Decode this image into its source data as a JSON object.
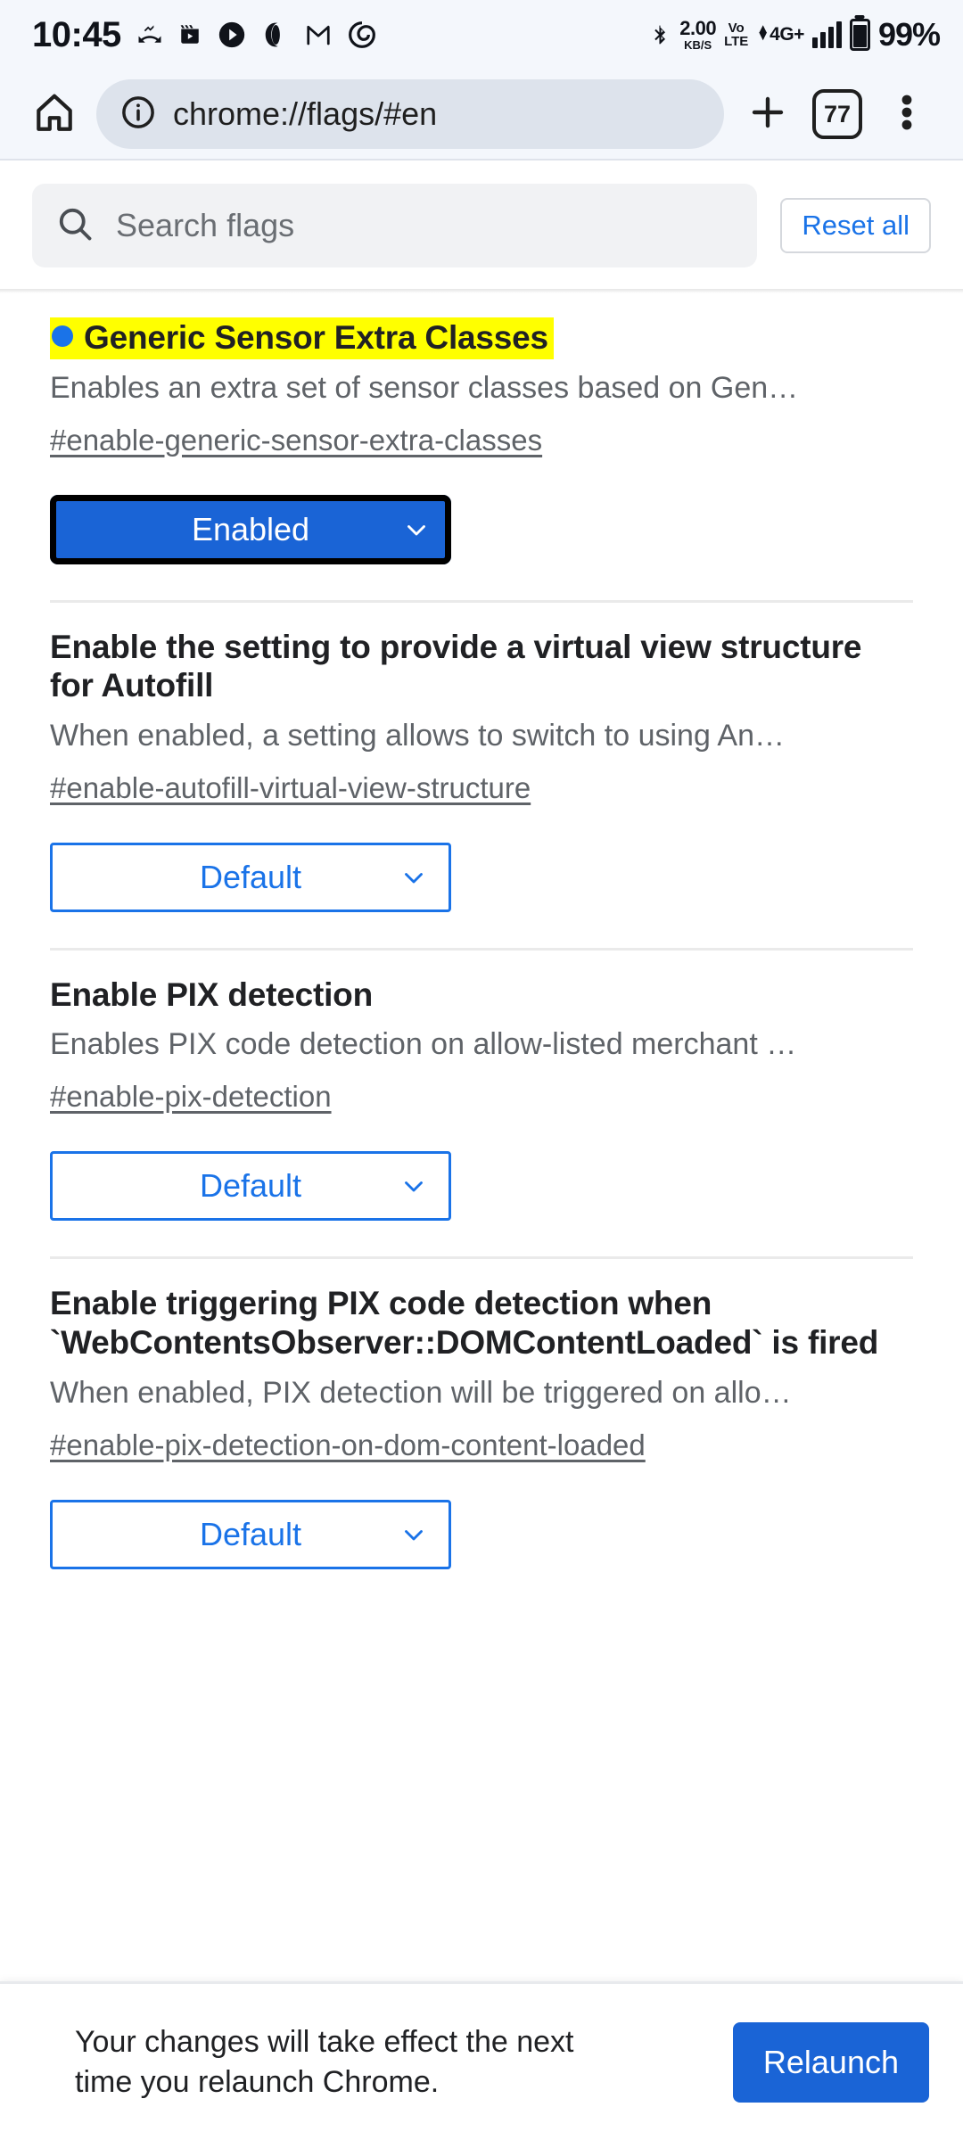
{
  "statusbar": {
    "time": "10:45",
    "icons": [
      "missed-call-icon",
      "video-camera-icon",
      "play-circle-icon",
      "opera-icon",
      "gmail-icon",
      "spiral-icon"
    ],
    "bluetooth": "bluetooth-icon",
    "net_speed_value": "2.00",
    "net_speed_unit": "KB/S",
    "volte_top": "Vo",
    "volte_bottom": "LTE",
    "network_type": "4G+",
    "battery_percent": "99%"
  },
  "toolbar": {
    "home_icon": "home-icon",
    "info_icon": "info-circle-icon",
    "url": "chrome://flags/#en",
    "new_tab_icon": "plus-icon",
    "tab_count": "77",
    "menu_icon": "more-vert-icon"
  },
  "search": {
    "icon": "search-icon",
    "placeholder": "Search flags",
    "reset_label": "Reset all"
  },
  "flags": [
    {
      "title": "Generic Sensor Extra Classes",
      "highlighted": true,
      "has_dot": true,
      "description": "Enables an extra set of sensor classes based on Gen…",
      "id": "#enable-generic-sensor-extra-classes",
      "state": "Enabled",
      "state_style": "enabled"
    },
    {
      "title": "Enable the setting to provide a virtual view structure for Autofill",
      "highlighted": false,
      "has_dot": false,
      "description": "When enabled, a setting allows to switch to using An…",
      "id": "#enable-autofill-virtual-view-structure",
      "state": "Default",
      "state_style": "default"
    },
    {
      "title": "Enable PIX detection",
      "highlighted": false,
      "has_dot": false,
      "description": "Enables PIX code detection on allow-listed merchant …",
      "id": "#enable-pix-detection",
      "state": "Default",
      "state_style": "default"
    },
    {
      "title": "Enable triggering PIX code detection when `WebContentsObserver::DOMContentLoaded` is fired",
      "highlighted": false,
      "has_dot": false,
      "description": "When enabled, PIX detection will be triggered on allo…",
      "id": "#enable-pix-detection-on-dom-content-loaded",
      "state": "Default",
      "state_style": "default"
    }
  ],
  "bottom": {
    "message": "Your changes will take effect the next time you relaunch Chrome.",
    "button_label": "Relaunch"
  },
  "colors": {
    "accent": "#1a73e8",
    "enabled_blue": "#1a64d6",
    "highlight": "#ffff00",
    "chrome_bg": "#f4f7fc",
    "omnibox_bg": "#dde3ec"
  }
}
